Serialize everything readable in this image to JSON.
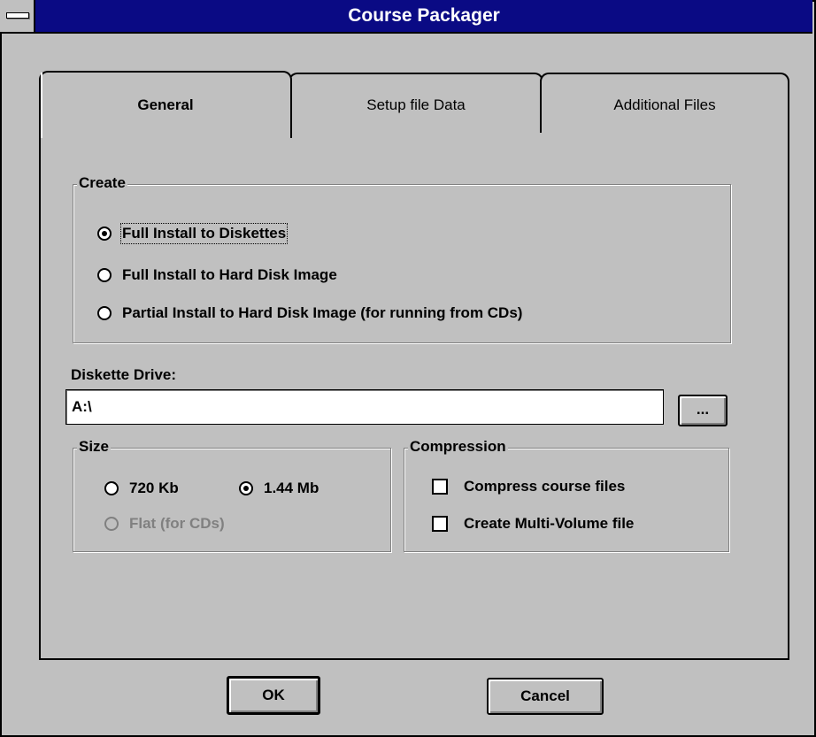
{
  "window": {
    "title": "Course Packager"
  },
  "tabs": [
    {
      "label": "General",
      "active": true
    },
    {
      "label": "Setup file Data",
      "active": false
    },
    {
      "label": "Additional Files",
      "active": false
    }
  ],
  "create_group": {
    "label": "Create",
    "options": [
      {
        "label": "Full Install to Diskettes",
        "checked": true
      },
      {
        "label": "Full Install to Hard Disk Image",
        "checked": false
      },
      {
        "label": "Partial Install to Hard Disk Image (for running from CDs)",
        "checked": false
      }
    ]
  },
  "diskette_drive": {
    "label": "Diskette Drive:",
    "value": "A:\\",
    "browse_label": "..."
  },
  "size_group": {
    "label": "Size",
    "options": [
      {
        "label": "720 Kb",
        "checked": false,
        "enabled": true
      },
      {
        "label": "1.44 Mb",
        "checked": true,
        "enabled": true
      },
      {
        "label": "Flat (for CDs)",
        "checked": false,
        "enabled": false
      }
    ]
  },
  "compression_group": {
    "label": "Compression",
    "options": [
      {
        "label": "Compress course files",
        "checked": false
      },
      {
        "label": "Create Multi-Volume file",
        "checked": false
      }
    ]
  },
  "buttons": {
    "ok_label": "OK",
    "cancel_label": "Cancel"
  }
}
